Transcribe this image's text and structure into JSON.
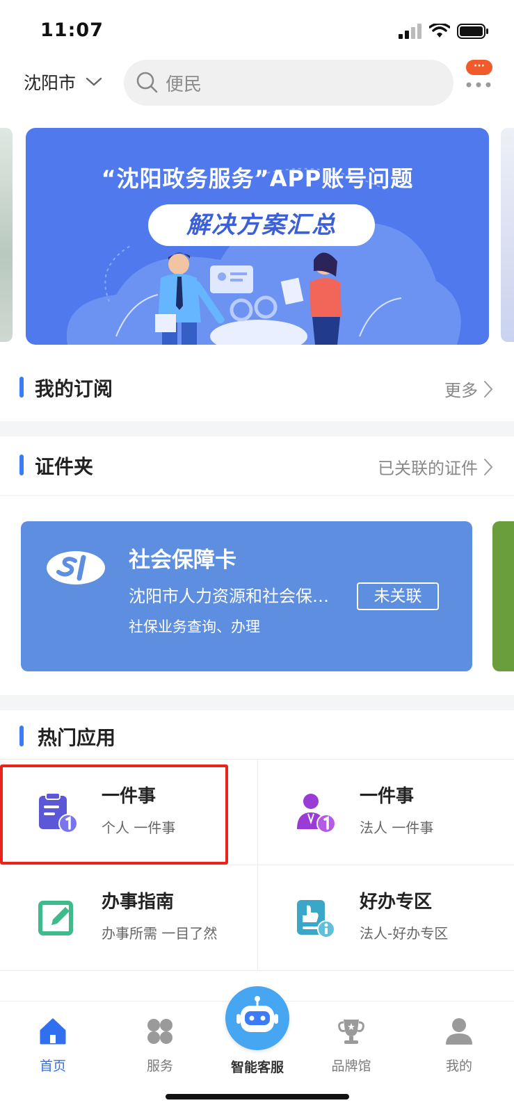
{
  "status_bar": {
    "time": "11:07"
  },
  "header": {
    "city": "沈阳市",
    "search_placeholder": "便民",
    "badge_text": "···"
  },
  "banner": {
    "title": "“沈阳政务服务”APP账号问题",
    "subtitle": "解决方案汇总"
  },
  "subscription": {
    "title": "我的订阅",
    "more": "更多"
  },
  "cert_folder": {
    "title": "证件夹",
    "linked": "已关联的证件"
  },
  "card": {
    "title": "社会保障卡",
    "issuer": "沈阳市人力资源和社会保…",
    "desc": "社保业务查询、办理",
    "status_button": "未关联"
  },
  "hot_apps": {
    "title": "热门应用",
    "items": [
      {
        "name": "一件事",
        "desc": "个人 一件事",
        "icon": "clipboard-one-icon",
        "color": "#5b57d6"
      },
      {
        "name": "一件事",
        "desc": "法人 一件事",
        "icon": "person-one-icon",
        "color": "#9b3bd6"
      },
      {
        "name": "办事指南",
        "desc": "办事所需 一目了然",
        "icon": "edit-guide-icon",
        "color": "#3dbb8a"
      },
      {
        "name": "好办专区",
        "desc": "法人-好办专区",
        "icon": "thumbs-info-icon",
        "color": "#3aa7c9"
      }
    ]
  },
  "tabs": [
    {
      "label": "首页",
      "icon": "home-icon",
      "active": true
    },
    {
      "label": "服务",
      "icon": "grid-icon",
      "active": false
    },
    {
      "label": "智能客服",
      "icon": "robot-icon",
      "active": false
    },
    {
      "label": "品牌馆",
      "icon": "trophy-icon",
      "active": false
    },
    {
      "label": "我的",
      "icon": "user-icon",
      "active": false
    }
  ],
  "colors": {
    "accent": "#3b7bf5",
    "banner": "#4f79ec",
    "card": "#5d8ee0",
    "highlight": "#e8241d"
  }
}
